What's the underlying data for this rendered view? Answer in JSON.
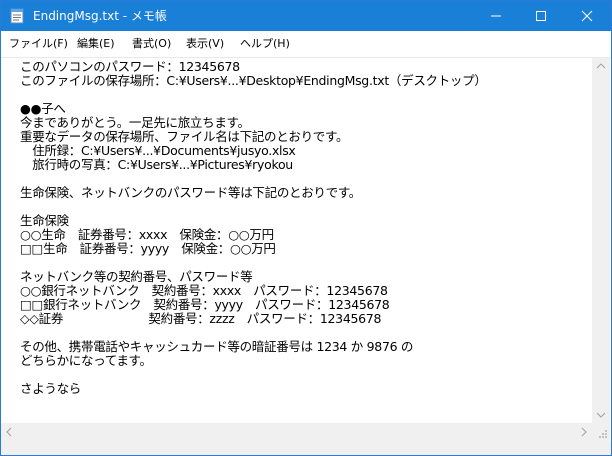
{
  "window": {
    "title": "EndingMsg.txt - メモ帳"
  },
  "menu": [
    {
      "label": "ファイル(F)"
    },
    {
      "label": "編集(E)"
    },
    {
      "label": "書式(O)"
    },
    {
      "label": "表示(V)"
    },
    {
      "label": "ヘルプ(H)"
    }
  ],
  "document": {
    "lines": [
      "このパソコンのパスワード：12345678",
      "このファイルの保存場所：C:¥Users¥...¥Desktop¥EndingMsg.txt（デスクトップ）",
      "",
      "●●子へ",
      "今までありがとう。一足先に旅立ちます。",
      "重要なデータの保存場所、ファイル名は下記のとおりです。",
      "　住所録：C:¥Users¥...¥Documents¥jusyo.xlsx",
      "　旅行時の写真：C:¥Users¥...¥Pictures¥ryokou",
      "",
      "生命保険、ネットバンクのパスワード等は下記のとおりです。",
      "",
      "生命保険",
      "○○生命　証券番号：xxxx　保険金：○○万円",
      "□□生命　証券番号：yyyy　保険金：○○万円",
      "",
      "ネットバンク等の契約番号、パスワード等",
      "○○銀行ネットバンク　契約番号：xxxx　パスワード：12345678",
      "□□銀行ネットバンク　契約番号：yyyy　パスワード：12345678",
      "◇◇証券　　　　　　　契約番号：zzzz　パスワード：12345678",
      "",
      "その他、携帯電話やキャッシュカード等の暗証番号は 1234 か 9876 の",
      "どちらかになってます。",
      "",
      "さようなら"
    ]
  },
  "icons": {
    "app": "notepad-icon",
    "minimize": "minimize-icon",
    "maximize": "maximize-icon",
    "close": "close-icon"
  },
  "colors": {
    "titlebar": "#1a7fd6",
    "border": "#2b7bd6"
  }
}
